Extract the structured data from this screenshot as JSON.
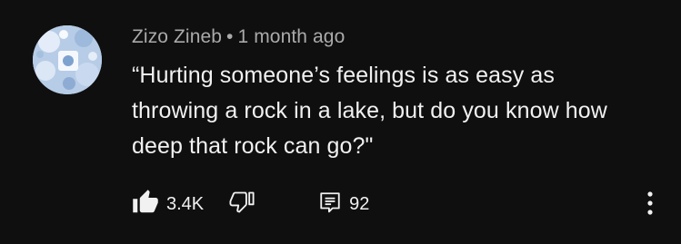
{
  "comment": {
    "author": "Zizo Zineb",
    "separator": "•",
    "timestamp": "1 month ago",
    "text": "“Hurting someone’s feelings is as easy as throwing a rock in a lake, but do you know how deep that rock can go?\"",
    "likes": "3.4K",
    "replies": "92"
  },
  "icons": {
    "like": "thumbs-up-icon",
    "dislike": "thumbs-down-icon",
    "replies": "comment-icon",
    "more": "more-vertical-icon"
  },
  "colors": {
    "background": "#0f0f0f",
    "text": "#f1f1f1",
    "secondary_text": "#aaaaaa"
  }
}
